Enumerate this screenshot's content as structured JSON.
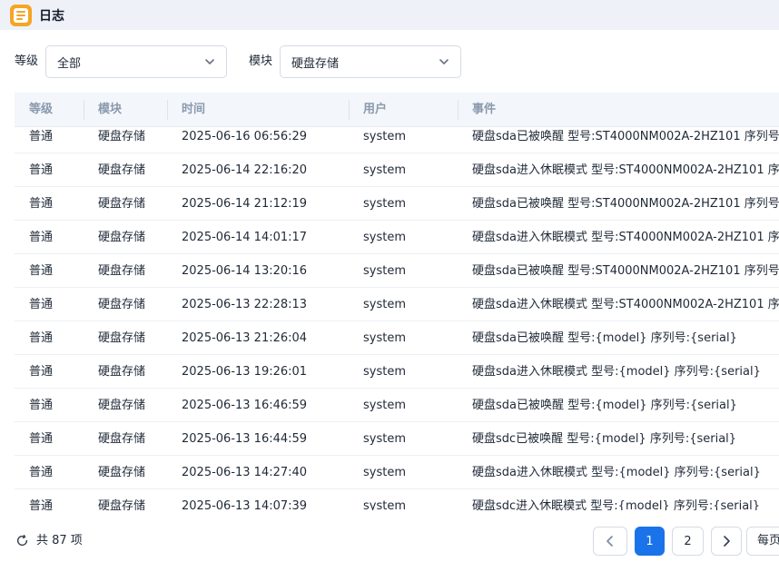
{
  "window": {
    "title": "日志",
    "icon": "log-icon"
  },
  "filters": {
    "level_label": "等级",
    "level_value": "全部",
    "module_label": "模块",
    "module_value": "硬盘存储"
  },
  "table": {
    "columns": [
      "等级",
      "模块",
      "时间",
      "用户",
      "事件"
    ],
    "rows": [
      {
        "level": "普通",
        "module": "硬盘存储",
        "time": "2025-06-16 06:56:29",
        "user": "system",
        "event": "硬盘sda已被唤醒 型号:ST4000NM002A-2HZ101 序列号"
      },
      {
        "level": "普通",
        "module": "硬盘存储",
        "time": "2025-06-14 22:16:20",
        "user": "system",
        "event": "硬盘sda进入休眠模式 型号:ST4000NM002A-2HZ101 序"
      },
      {
        "level": "普通",
        "module": "硬盘存储",
        "time": "2025-06-14 21:12:19",
        "user": "system",
        "event": "硬盘sda已被唤醒 型号:ST4000NM002A-2HZ101 序列号"
      },
      {
        "level": "普通",
        "module": "硬盘存储",
        "time": "2025-06-14 14:01:17",
        "user": "system",
        "event": "硬盘sda进入休眠模式 型号:ST4000NM002A-2HZ101 序"
      },
      {
        "level": "普通",
        "module": "硬盘存储",
        "time": "2025-06-14 13:20:16",
        "user": "system",
        "event": "硬盘sda已被唤醒 型号:ST4000NM002A-2HZ101 序列号"
      },
      {
        "level": "普通",
        "module": "硬盘存储",
        "time": "2025-06-13 22:28:13",
        "user": "system",
        "event": "硬盘sda进入休眠模式 型号:ST4000NM002A-2HZ101 序"
      },
      {
        "level": "普通",
        "module": "硬盘存储",
        "time": "2025-06-13 21:26:04",
        "user": "system",
        "event": "硬盘sda已被唤醒 型号:{model} 序列号:{serial}"
      },
      {
        "level": "普通",
        "module": "硬盘存储",
        "time": "2025-06-13 19:26:01",
        "user": "system",
        "event": "硬盘sda进入休眠模式 型号:{model} 序列号:{serial}"
      },
      {
        "level": "普通",
        "module": "硬盘存储",
        "time": "2025-06-13 16:46:59",
        "user": "system",
        "event": "硬盘sda已被唤醒 型号:{model} 序列号:{serial}"
      },
      {
        "level": "普通",
        "module": "硬盘存储",
        "time": "2025-06-13 16:44:59",
        "user": "system",
        "event": "硬盘sdc已被唤醒 型号:{model} 序列号:{serial}"
      },
      {
        "level": "普通",
        "module": "硬盘存储",
        "time": "2025-06-13 14:27:40",
        "user": "system",
        "event": "硬盘sda进入休眠模式 型号:{model} 序列号:{serial}"
      },
      {
        "level": "普通",
        "module": "硬盘存储",
        "time": "2025-06-13 14:07:39",
        "user": "system",
        "event": "硬盘sdc进入休眠模式 型号:{model} 序列号:{serial}"
      }
    ]
  },
  "footer": {
    "total_text": "共 87 项",
    "pages": [
      "1",
      "2"
    ],
    "current_page": "1",
    "page_size_label": "每页"
  },
  "colors": {
    "accent": "#1a73e8",
    "app_icon": "#f5a524",
    "header_text": "#8a99ad"
  }
}
